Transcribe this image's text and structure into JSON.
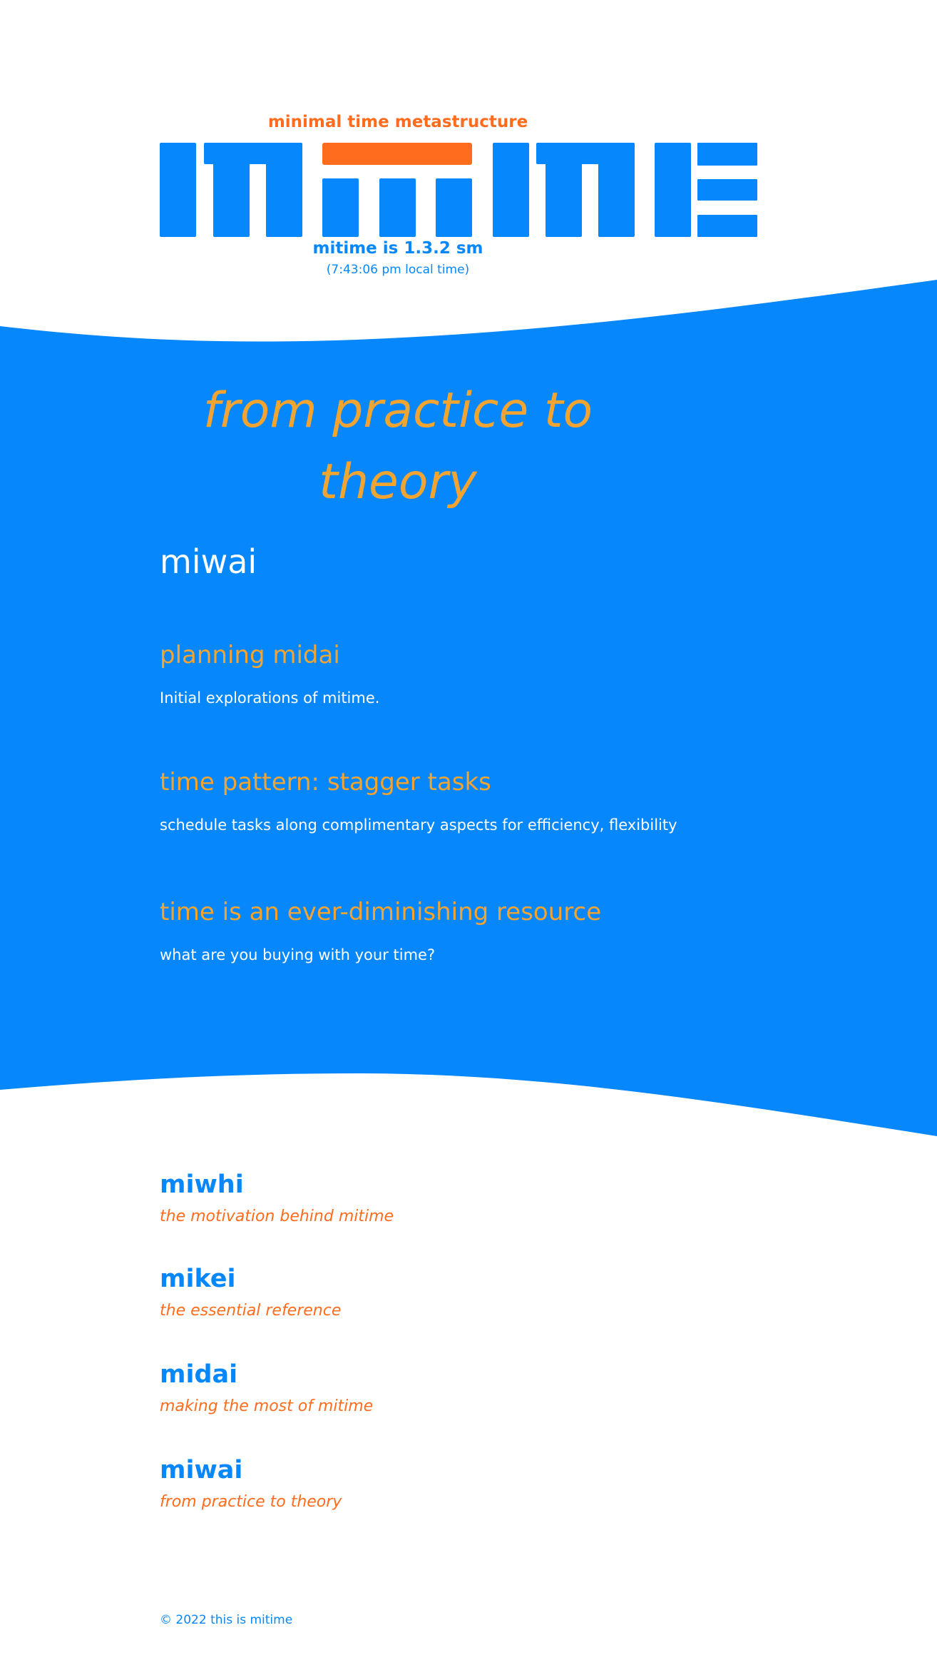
{
  "header": {
    "tagline": "minimal time metastructure",
    "version_text": "mitime is 1.3.2 sm",
    "local_time": "(7:43:06 pm local time)"
  },
  "logo": {
    "alt": "mitime",
    "primary_color": "#0787fc",
    "accent_color": "#ff6c1e"
  },
  "hero": {
    "line1": "from practice to",
    "line2": "theory"
  },
  "section": {
    "title": "miwai"
  },
  "posts": [
    {
      "title": "planning midai",
      "description": "Initial explorations of mitime."
    },
    {
      "title": "time pattern: stagger tasks",
      "description": "schedule tasks along complimentary aspects for efficiency, flexibility"
    },
    {
      "title": "time is an ever-diminishing resource",
      "description": "what are you buying with your time?"
    }
  ],
  "nav": [
    {
      "name": "miwhi",
      "description": "the motivation behind mitime"
    },
    {
      "name": "mikei",
      "description": "the essential reference"
    },
    {
      "name": "midai",
      "description": "making the most of mitime"
    },
    {
      "name": "miwai",
      "description": "from practice to theory"
    }
  ],
  "footer": {
    "text": "© 2022 this is mitime"
  },
  "colors": {
    "blue": "#0787fc",
    "orange": "#ff6c1e",
    "gold": "#f2a431",
    "white": "#ffffff"
  }
}
